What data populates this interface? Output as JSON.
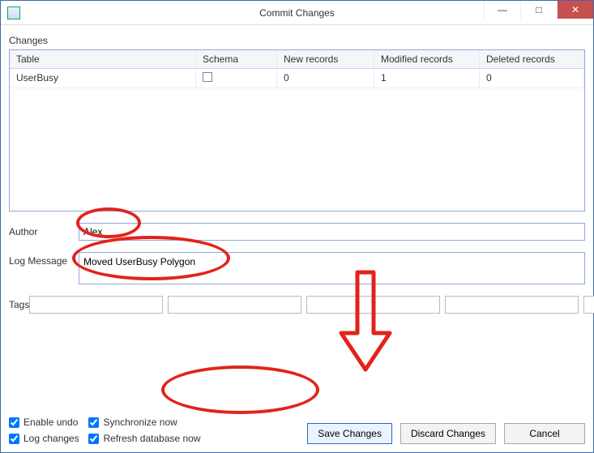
{
  "window": {
    "title": "Commit Changes"
  },
  "changes": {
    "group_label": "Changes",
    "columns": {
      "table": "Table",
      "schema": "Schema",
      "new_records": "New records",
      "modified_records": "Modified records",
      "deleted_records": "Deleted records"
    },
    "rows": [
      {
        "table": "UserBusy",
        "schema_checked": false,
        "new_records": "0",
        "modified_records": "1",
        "deleted_records": "0"
      }
    ]
  },
  "form": {
    "author_label": "Author",
    "author_value": "Alex",
    "log_label": "Log Message",
    "log_value": "Moved UserBusy Polygon",
    "tags_label": "Tags"
  },
  "options": {
    "enable_undo": "Enable undo",
    "log_changes": "Log changes",
    "synchronize_now": "Synchronize now",
    "refresh_db_now": "Refresh database now"
  },
  "buttons": {
    "save": "Save Changes",
    "discard": "Discard Changes",
    "cancel": "Cancel"
  }
}
